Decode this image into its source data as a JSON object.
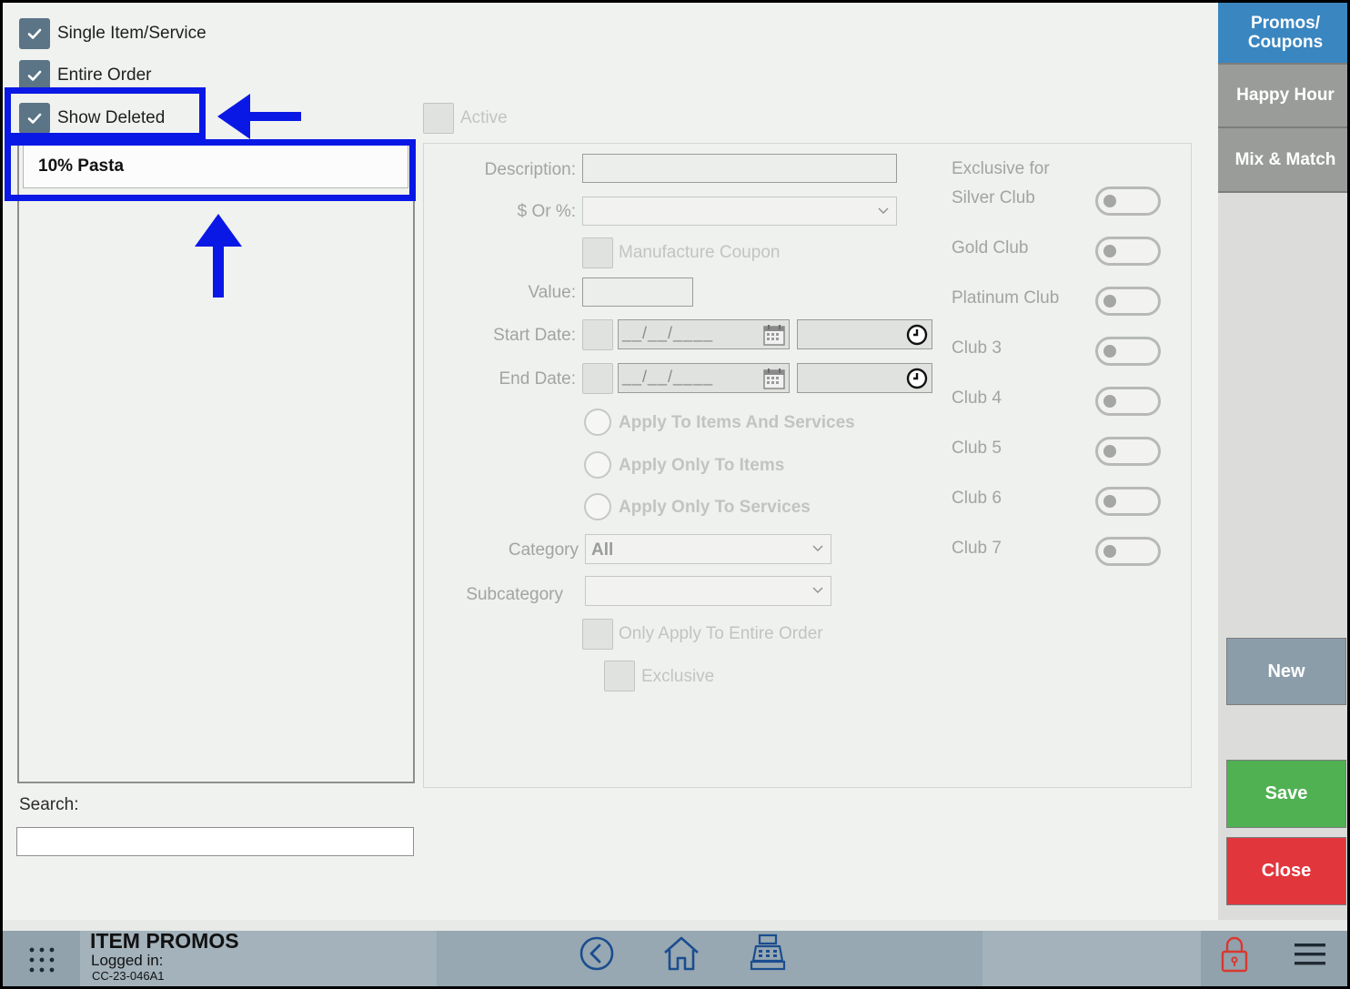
{
  "filters": {
    "single_item": "Single Item/Service",
    "entire_order": "Entire Order",
    "show_deleted": "Show Deleted"
  },
  "list": {
    "items": [
      "10% Pasta"
    ]
  },
  "search": {
    "label": "Search:",
    "value": ""
  },
  "form": {
    "active_label": "Active",
    "description_label": "Description:",
    "dollar_or_percent_label": "$ Or %:",
    "manufacture_coupon_label": "Manufacture Coupon",
    "value_label": "Value:",
    "start_date_label": "Start Date:",
    "end_date_label": "End Date:",
    "start_date_value": "__/__/____",
    "end_date_value": "__/__/____",
    "radio_options": [
      "Apply To Items And Services",
      "Apply Only To Items",
      "Apply Only To Services"
    ],
    "category_label": "Category",
    "category_value": "All",
    "subcategory_label": "Subcategory",
    "only_apply_entire_order_label": "Only Apply To Entire Order",
    "exclusive_label": "Exclusive"
  },
  "clubs": {
    "heading": "Exclusive for",
    "items": [
      "Silver Club",
      "Gold Club",
      "Platinum Club",
      "Club 3",
      "Club 4",
      "Club 5",
      "Club 6",
      "Club 7"
    ]
  },
  "sidebar": {
    "tabs": [
      "Promos/ Coupons",
      "Happy Hour",
      "Mix & Match"
    ],
    "new_label": "New",
    "save_label": "Save",
    "close_label": "Close"
  },
  "bottom": {
    "title": "ITEM PROMOS",
    "logged_in_label": "Logged in:",
    "station": "CC-23-046A1"
  },
  "colors": {
    "highlight": "#0a18e6",
    "tab_active": "#3a86c0",
    "tab_inactive": "#9a9c9a",
    "new_button": "#8c9daa",
    "save_button": "#50b152",
    "close_button": "#e2363d"
  }
}
